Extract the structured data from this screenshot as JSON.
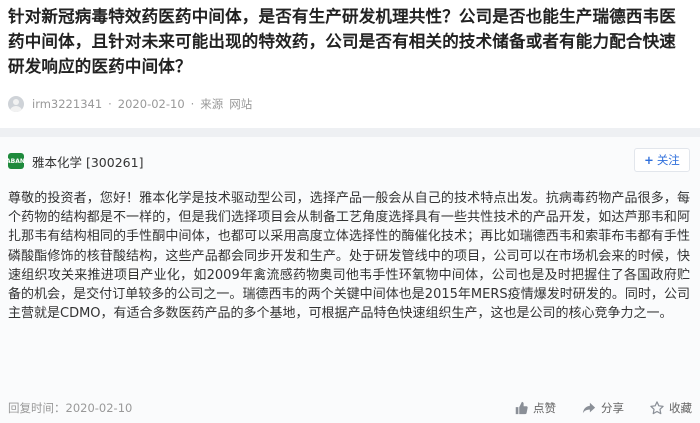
{
  "question": {
    "title": "针对新冠病毒特效药医药中间体，是否有生产研发机理共性？公司是否也能生产瑞德西韦医药中间体，且针对未来可能出现的特效药，公司是否有相关的技术储备或者有能力配合快速研发响应的医药中间体？",
    "username": "irm3221341",
    "date": "2020-02-10",
    "source_label": "来源",
    "source": "网站"
  },
  "answer": {
    "company": "雅本化学 [300261]",
    "logo_text": "YABANG",
    "follow_label": "关注",
    "body": "尊敬的投资者，您好！雅本化学是技术驱动型公司，选择产品一般会从自己的技术特点出发。抗病毒药物产品很多，每个药物的结构都是不一样的，但是我们选择项目会从制备工艺角度选择具有一些共性技术的产品开发，如达芦那韦和阿扎那韦有结构相同的手性酮中间体，也都可以采用高度立体选择性的酶催化技术；再比如瑞德西韦和索菲布韦都有手性磷酸酯修饰的核苷酸结构，这些产品都会同步开发和生产。处于研发管线中的项目，公司可以在市场机会来的时候，快速组织攻关来推进项目产业化，如2009年禽流感药物奥司他韦手性环氧物中间体，公司也是及时把握住了各国政府贮备的机会，是交付订单较多的公司之一。瑞德西韦的两个关键中间体也是2015年MERS疫情爆发时研发的。同时，公司主营就是CDMO，有适合多数医药产品的多个基地，可根据产品特色快速组织生产，这也是公司的核心竞争力之一。",
    "reply_time_label": "回复时间：",
    "reply_time": "2020-02-10",
    "actions": {
      "like": "点赞",
      "share": "分享",
      "collect": "收藏"
    }
  }
}
